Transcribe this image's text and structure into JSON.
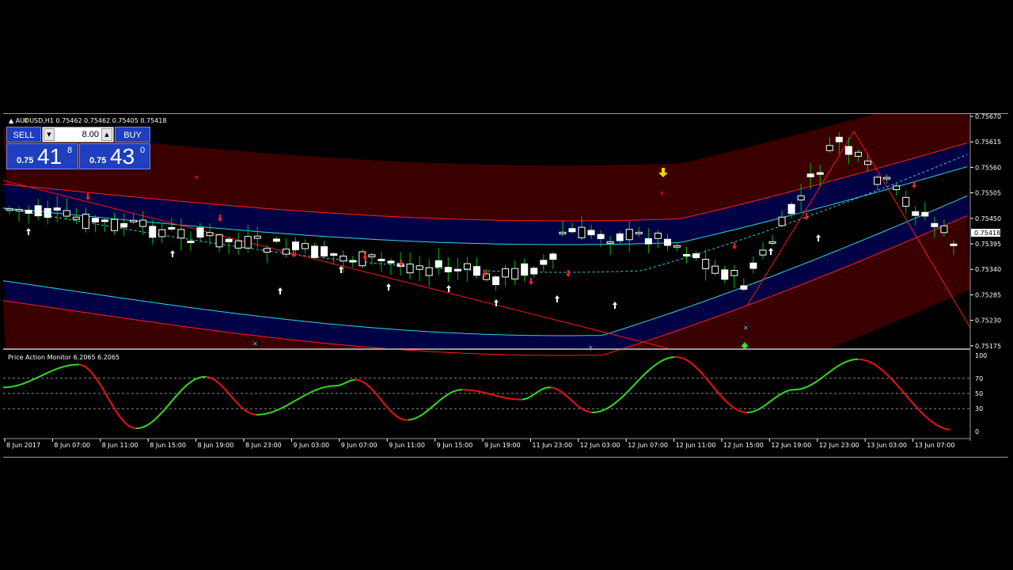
{
  "main_chart": {
    "title": "AUDUSD,H1",
    "ohlc": "0.75462 0.75462 0.75405 0.75418",
    "current_price": "0.75418",
    "price_labels": [
      "0.75670",
      "0.75615",
      "0.75560",
      "0.75505",
      "0.75450",
      "0.75395",
      "0.75340",
      "0.75285",
      "0.75230",
      "0.75175"
    ]
  },
  "trade_panel": {
    "sell_label": "SELL",
    "buy_label": "BUY",
    "lot": "8.00",
    "sell_small": "0.75",
    "sell_big": "41",
    "sell_sup": "8",
    "buy_small": "0.75",
    "buy_big": "43",
    "buy_sup": "0"
  },
  "indicator": {
    "title": "Price Action Monitor 6.2065 6.2065",
    "levels": [
      "100",
      "70",
      "50",
      "30",
      "0"
    ]
  },
  "time_axis": [
    "8 Jun 2017",
    "8 Jun 07:00",
    "8 Jun 11:00",
    "8 Jun 15:00",
    "8 Jun 19:00",
    "8 Jun 23:00",
    "9 Jun 03:00",
    "9 Jun 07:00",
    "9 Jun 11:00",
    "9 Jun 15:00",
    "9 Jun 19:00",
    "11 Jun 23:00",
    "12 Jun 03:00",
    "12 Jun 07:00",
    "12 Jun 11:00",
    "12 Jun 15:00",
    "12 Jun 19:00",
    "12 Jun 23:00",
    "13 Jun 03:00",
    "13 Jun 07:00"
  ],
  "colors": {
    "bull": "#ffffff",
    "bear": "#ffffff",
    "wick": "#00c000",
    "band_red": "#ff1e1e",
    "band_fill_red": "#3a0000",
    "band_fill_blue": "#000044",
    "band_cyan": "#2fd5e6",
    "trend_red": "#ff1010",
    "osc_up": "#33dd22",
    "osc_down": "#ee1111"
  }
}
